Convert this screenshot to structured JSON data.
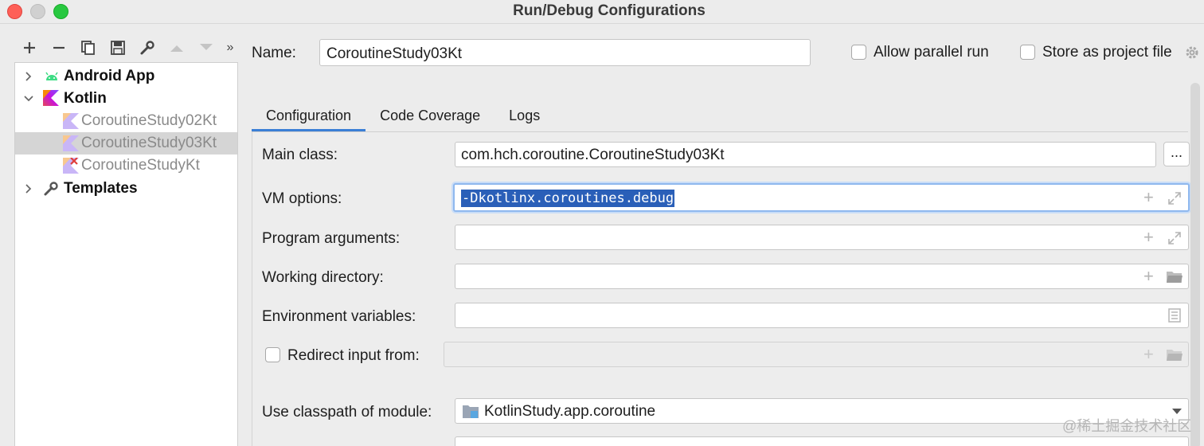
{
  "window": {
    "title": "Run/Debug Configurations"
  },
  "tree": {
    "items": [
      {
        "label": "Android App",
        "level": 0,
        "expanded": false
      },
      {
        "label": "Kotlin",
        "level": 0,
        "expanded": true
      },
      {
        "label": "CoroutineStudy02Kt",
        "level": 1
      },
      {
        "label": "CoroutineStudy03Kt",
        "level": 1,
        "selected": true
      },
      {
        "label": "CoroutineStudyKt",
        "level": 1,
        "error": true
      },
      {
        "label": "Templates",
        "level": 0,
        "expanded": false
      }
    ]
  },
  "config": {
    "name_label": "Name:",
    "name_value": "CoroutineStudy03Kt",
    "allow_parallel_label": "Allow parallel run",
    "store_project_label": "Store as project file"
  },
  "tabs": [
    {
      "label": "Configuration",
      "active": true
    },
    {
      "label": "Code Coverage"
    },
    {
      "label": "Logs"
    }
  ],
  "form": {
    "main_class_label": "Main class:",
    "main_class_value": "com.hch.coroutine.CoroutineStudy03Kt",
    "ellipsis": "...",
    "vm_options_label": "VM options:",
    "vm_options_value": "-Dkotlinx.coroutines.debug",
    "program_args_label": "Program arguments:",
    "working_dir_label": "Working directory:",
    "env_vars_label": "Environment variables:",
    "redirect_label": "Redirect input from:",
    "classpath_label": "Use classpath of module:",
    "classpath_value": "KotlinStudy.app.coroutine"
  },
  "watermark": "@稀土掘金技术社区",
  "colors": {
    "accent": "#3b7fd6",
    "selection": "#2a5fb8",
    "kotlin_orange": "#e44857",
    "android_green": "#3ddc84"
  }
}
